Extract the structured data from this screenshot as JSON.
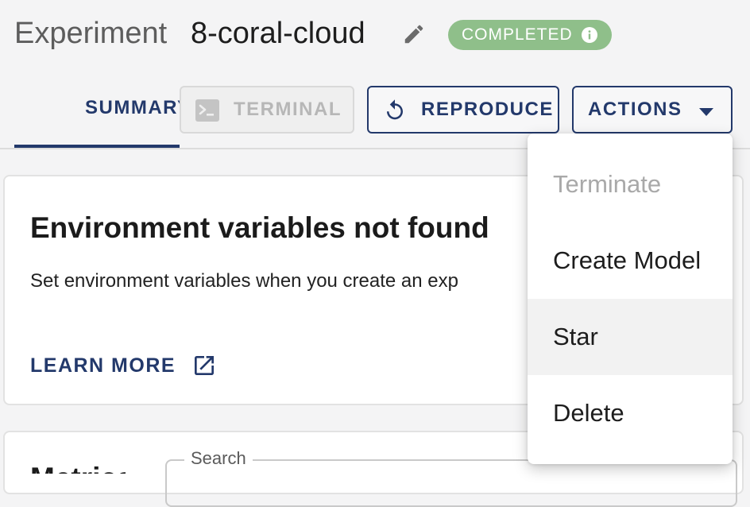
{
  "header": {
    "label": "Experiment",
    "name": "8-coral-cloud",
    "status": "COMPLETED",
    "status_color": "#8fbf8a"
  },
  "tabs": {
    "summary": "SUMMARY"
  },
  "toolbar": {
    "terminal": "TERMINAL",
    "reproduce": "REPRODUCE",
    "actions": "ACTIONS"
  },
  "actions_menu": {
    "items": [
      {
        "label": "Terminate",
        "disabled": true
      },
      {
        "label": "Create Model",
        "disabled": false
      },
      {
        "label": "Star",
        "disabled": false
      },
      {
        "label": "Delete",
        "disabled": false
      }
    ]
  },
  "env_card": {
    "title": "Environment variables not found",
    "description": "Set environment variables when you create an exp",
    "link": "LEARN MORE"
  },
  "metrics_card": {
    "title": "Metrics",
    "search_label": "Search"
  },
  "colors": {
    "accent": "#23396b",
    "background": "#f4f4f5"
  },
  "icons": {
    "edit": "pencil-icon",
    "info": "info-icon",
    "terminal": "terminal-icon",
    "reproduce": "rotate-icon",
    "caret": "caret-down-icon",
    "external": "external-link-icon"
  }
}
